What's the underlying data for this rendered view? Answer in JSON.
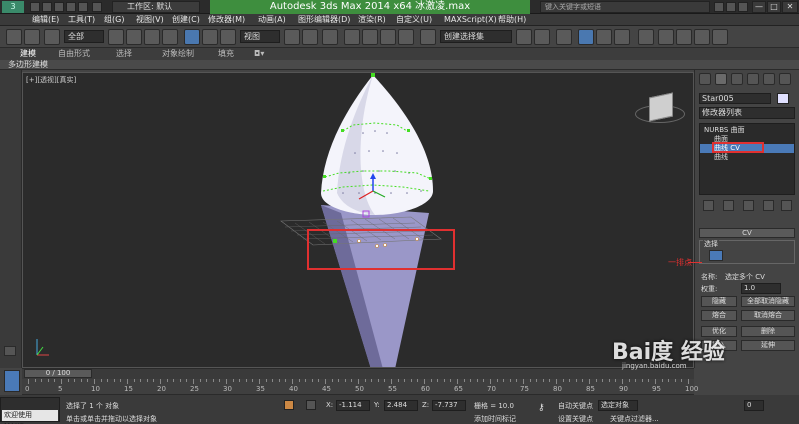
{
  "titlebar": {
    "workspace_label": "工作区: 默认",
    "app_title": "Autodesk 3ds Max  2014 x64    冰激凌.max",
    "search_placeholder": "键入关键字或短语",
    "minimize": "—",
    "maximize": "□",
    "close": "✕"
  },
  "menubar": {
    "items": [
      "编辑(E)",
      "工具(T)",
      "组(G)",
      "视图(V)",
      "创建(C)",
      "修改器(M)",
      "动画(A)",
      "图形编辑器(D)",
      "渲染(R)",
      "自定义(U)",
      "MAXScript(X)",
      "帮助(H)"
    ]
  },
  "toolbar": {
    "selection_filter": "全部",
    "reference_coord": "视图",
    "named_selection": "创建选择集"
  },
  "ribbon": {
    "tabs": [
      "建模",
      "自由形式",
      "选择",
      "对象绘制",
      "填充"
    ],
    "subpanel": "多边形建模"
  },
  "viewport": {
    "label": "[+][透视][真实]"
  },
  "command_panel": {
    "object_name": "Star005",
    "modifier_list": "修改器列表",
    "stack": [
      {
        "label": "NURBS 曲面",
        "selected": false
      },
      {
        "label": "曲面",
        "selected": false
      },
      {
        "label": "曲线 CV",
        "selected": true
      },
      {
        "label": "曲线",
        "selected": false
      }
    ],
    "rollout_title": "CV",
    "selection_group": "选择",
    "name_label": "名称:",
    "name_value": "选定多个 CV",
    "weight_label": "权重:",
    "weight_value": "1.0",
    "buttons": [
      "隐藏",
      "全部取消隐藏",
      "熔合",
      "取消熔合",
      "优化",
      "删除",
      "插入",
      "延伸"
    ]
  },
  "annotation": {
    "text": "一排点"
  },
  "timeline": {
    "slider_label": "0 / 100",
    "ticks": [
      "0",
      "5",
      "10",
      "15",
      "20",
      "25",
      "30",
      "35",
      "40",
      "45",
      "50",
      "55",
      "60",
      "65",
      "70",
      "75",
      "80",
      "85",
      "90",
      "95",
      "100"
    ]
  },
  "status": {
    "welcome": "欢迎使用 MAXSc",
    "selected_text": "选择了 1 个 对象",
    "prompt_text": "单击或单击并拖动以选择对象",
    "x_label": "X:",
    "x_value": "-1.114",
    "y_label": "Y:",
    "y_value": "2.484",
    "z_label": "Z:",
    "z_value": "-7.737",
    "grid_text": "栅格 = 10.0",
    "add_time_tag": "添加时间标记",
    "auto_key": "自动关键点",
    "selected_object": "选定对象",
    "set_key": "设置关键点",
    "key_filter": "关键点过滤器...",
    "frame_value": "0"
  },
  "watermark": {
    "text": "Bai度 经验",
    "url": "jingyan.baidu.com"
  },
  "colors": {
    "title_green": "#3e8e3e",
    "highlight_red": "#e03030",
    "selection_blue": "#4a7ab8",
    "cv_green": "#44dd22"
  }
}
